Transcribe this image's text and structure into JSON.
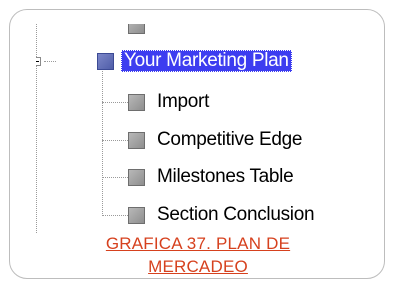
{
  "tree": {
    "parent": {
      "label": "Your Marketing Plan",
      "expanded": true,
      "selected": true
    },
    "children": [
      {
        "label": "Import"
      },
      {
        "label": "Competitive Edge"
      },
      {
        "label": "Milestones Table"
      },
      {
        "label": "Section Conclusion"
      }
    ]
  },
  "caption": {
    "line1": "GRAFICA 37. PLAN DE",
    "line2": "MERCADEO"
  },
  "colors": {
    "selection": "#3d3df0",
    "caption": "#d6411e"
  }
}
